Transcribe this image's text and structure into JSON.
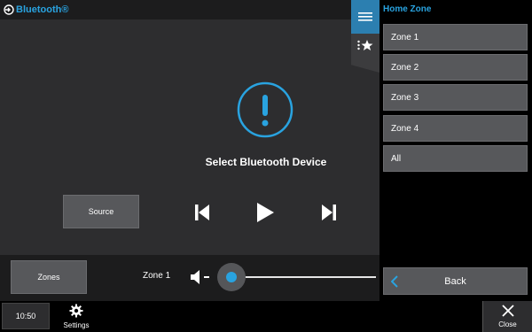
{
  "header": {
    "source_title": "Bluetooth®",
    "source_icon": "bluetooth-source-icon"
  },
  "side_tabs": {
    "menu_icon": "hamburger-menu-icon",
    "favorites_icon": "favorites-list-icon"
  },
  "main": {
    "alert_icon": "alert-exclamation-icon",
    "message": "Select Bluetooth Device",
    "source_label": "Source",
    "transport_icons": [
      "skip-previous-icon",
      "play-icon",
      "skip-next-icon"
    ],
    "zones_label": "Zones",
    "zone_name": "Zone 1",
    "volume_level": 0
  },
  "zone_panel": {
    "title": "Home Zone",
    "items": [
      "Zone 1",
      "Zone 2",
      "Zone 3",
      "Zone 4",
      "All"
    ],
    "back_label": "Back"
  },
  "footer": {
    "time": "10:50",
    "settings_label": "Settings",
    "close_label": "Close"
  },
  "colors": {
    "accent": "#29a3e0",
    "panel_bg": "#2d2d2f",
    "button_bg": "#57585b",
    "tab_active": "#2c7fb0"
  }
}
